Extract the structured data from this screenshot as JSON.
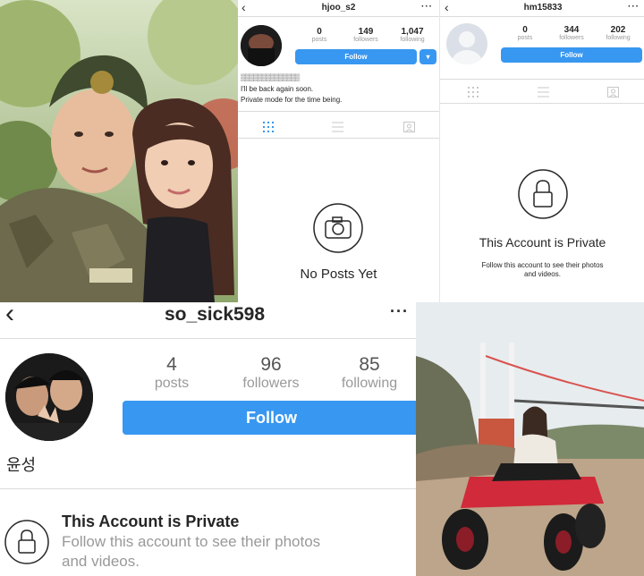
{
  "photo_left": {},
  "profile_a": {
    "username": "hjoo_s2",
    "back_icon": "chevron-left-icon",
    "more_label": "···",
    "stats": [
      {
        "value": "0",
        "label": "posts"
      },
      {
        "value": "149",
        "label": "followers"
      },
      {
        "value": "1,047",
        "label": "following"
      }
    ],
    "follow_label": "Follow",
    "dropdown_label": "▾",
    "display_name": "▒▒▒▒▒▒▒▒▒▒▒▒▒▒",
    "bio_lines": [
      "I'll be back again soon.",
      "Private mode for the time being."
    ],
    "empty_state": "No Posts Yet"
  },
  "profile_b": {
    "username": "hm15833",
    "more_label": "···",
    "stats": [
      {
        "value": "0",
        "label": "posts"
      },
      {
        "value": "344",
        "label": "followers"
      },
      {
        "value": "202",
        "label": "following"
      }
    ],
    "follow_label": "Follow",
    "private_title": "This Account is Private",
    "private_desc_1": "Follow this account to see their photos",
    "private_desc_2": "and videos."
  },
  "profile_c": {
    "username": "so_sick598",
    "more_label": "···",
    "stats": [
      {
        "value": "4",
        "label": "posts"
      },
      {
        "value": "96",
        "label": "followers"
      },
      {
        "value": "85",
        "label": "following"
      }
    ],
    "follow_label": "Follow",
    "display_name": "윤성",
    "private_title": "This Account is Private",
    "private_desc_1": "Follow this account to see their photos",
    "private_desc_2": "and videos."
  },
  "photo_right": {},
  "colors": {
    "follow_blue": "#3897f0",
    "muted_text": "#999999",
    "divider": "#dbdbdb",
    "tab_active": "#3897f0",
    "tab_inactive": "#c7c7c7"
  }
}
